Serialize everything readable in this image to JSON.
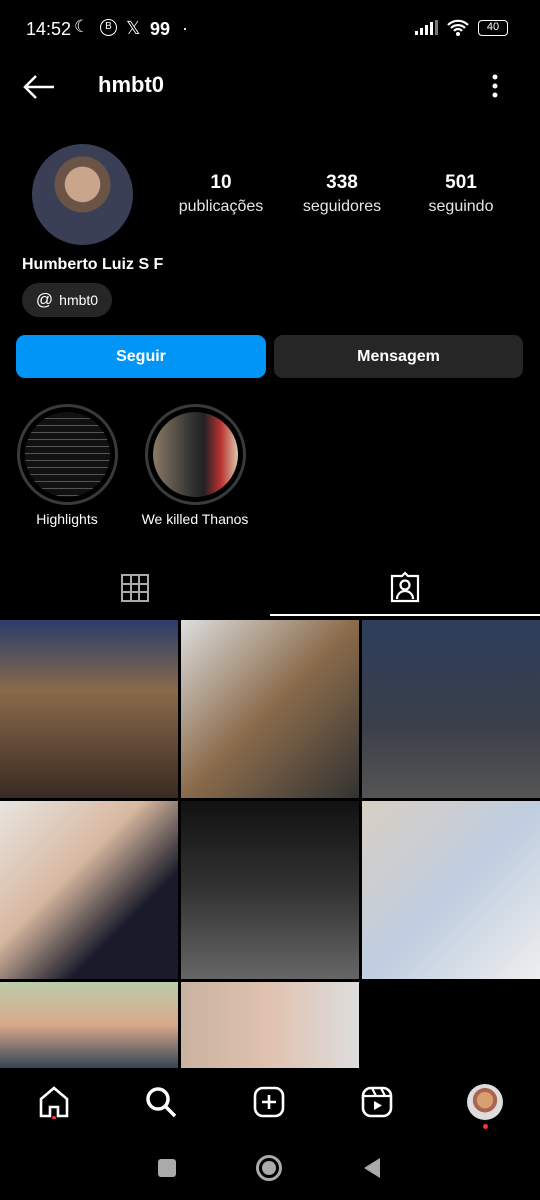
{
  "status_bar": {
    "time": "14:52",
    "notif": "99",
    "battery": "40"
  },
  "header": {
    "username": "hmbt0"
  },
  "profile": {
    "name": "Humberto Luiz S F",
    "threads_handle": "hmbt0",
    "stats": [
      {
        "value": "10",
        "label": "publicações"
      },
      {
        "value": "338",
        "label": "seguidores"
      },
      {
        "value": "501",
        "label": "seguindo"
      }
    ]
  },
  "actions": {
    "follow": "Seguir",
    "message": "Mensagem"
  },
  "highlights": [
    {
      "label": "Highlights"
    },
    {
      "label": "We killed Thanos"
    }
  ],
  "colors": {
    "accent": "#0095f6",
    "secondary_button": "#262626"
  }
}
